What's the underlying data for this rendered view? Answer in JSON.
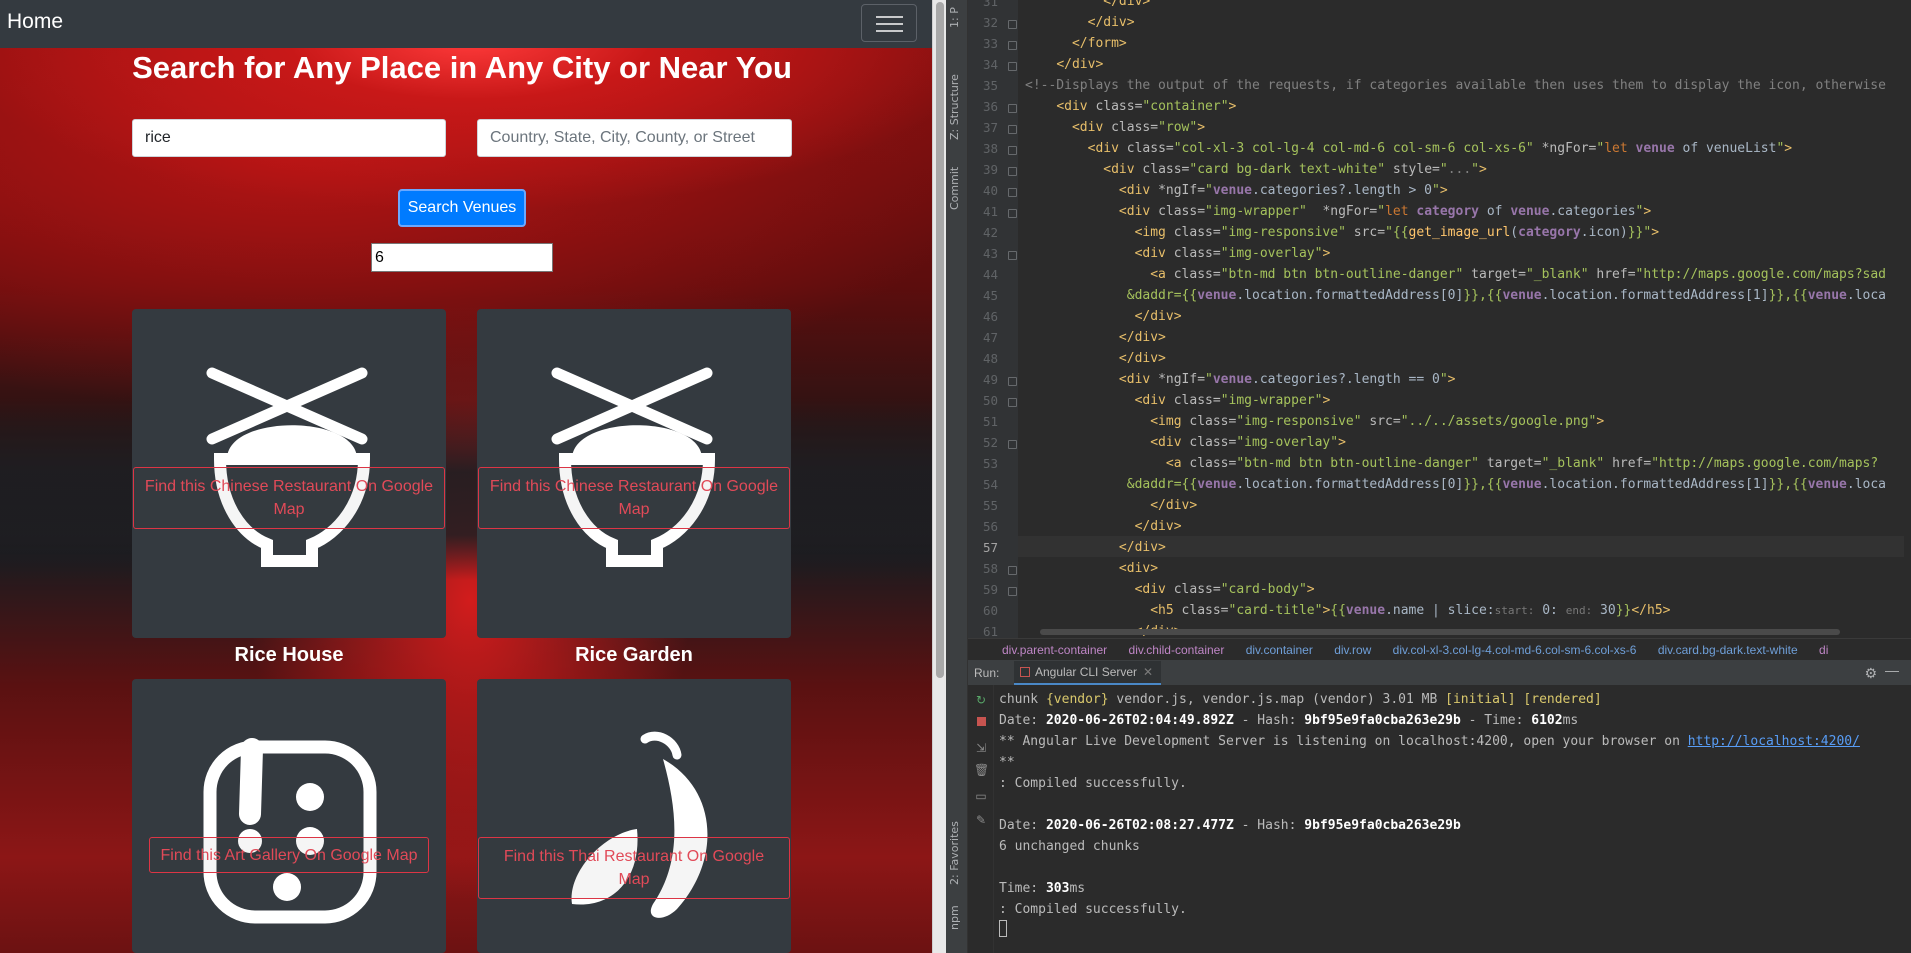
{
  "browser": {
    "navbar": {
      "brand": "Home"
    },
    "title": "Search for Any Place in Any City or Near You",
    "search": {
      "query_value": "rice",
      "location_placeholder": "Country, State, City, County, or Street",
      "button_label": "Search Venues",
      "limit_value": "6"
    },
    "cards": [
      {
        "name": "Rice House",
        "button": "Find this Chinese Restaurant On Google Map",
        "icon": "rice-bowl-chopsticks-icon"
      },
      {
        "name": "Rice Garden",
        "button": "Find this Chinese Restaurant On Google Map",
        "icon": "rice-bowl-chopsticks-icon"
      },
      {
        "name": "",
        "button": "Find this Art Gallery On Google Map",
        "icon": "art-palette-icon"
      },
      {
        "name": "",
        "button": "Find this Thai Restaurant On Google Map",
        "icon": "chili-pepper-icon"
      }
    ]
  },
  "ide": {
    "side_tabs": [
      "1: P",
      "Z: Structure",
      "Commit",
      "2: Favorites",
      "npm"
    ],
    "current_line": "57",
    "breadcrumb": [
      "div.parent-container",
      "div.child-container",
      "div.container",
      "div.row",
      "div.col-xl-3.col-lg-4.col-md-6.col-sm-6.col-xs-6",
      "div.card.bg-dark.text-white",
      "di"
    ],
    "run": {
      "label": "Run:",
      "tab": "Angular CLI Server"
    },
    "console": {
      "l1_pre": "chunk ",
      "l1_a": "{vendor}",
      "l1_b": " vendor.js, vendor.js.map (vendor) 3.01 MB ",
      "l1_c": "[initial]",
      "l1_d": " ",
      "l1_e": "[rendered]",
      "l2_a": "Date: ",
      "l2_b": "2020-06-26T02:04:49.892Z",
      "l2_c": " - Hash: ",
      "l2_d": "9bf95e9fa0cba263e29b",
      "l2_e": " - Time: ",
      "l2_f": "6102",
      "l2_g": "ms",
      "l3_a": "** Angular Live Development Server is listening on localhost:4200, open your browser on ",
      "l3_link": "http://localhost:4200/",
      "l4": "**",
      "l5": ": Compiled successfully.",
      "l6_a": "Date: ",
      "l6_b": "2020-06-26T02:08:27.477Z",
      "l6_c": " - Hash: ",
      "l6_d": "9bf95e9fa0cba263e29b",
      "l7": "6 unchanged chunks",
      "l8_a": "Time: ",
      "l8_b": "303",
      "l8_c": "ms",
      "l9": ": Compiled successfully."
    }
  }
}
